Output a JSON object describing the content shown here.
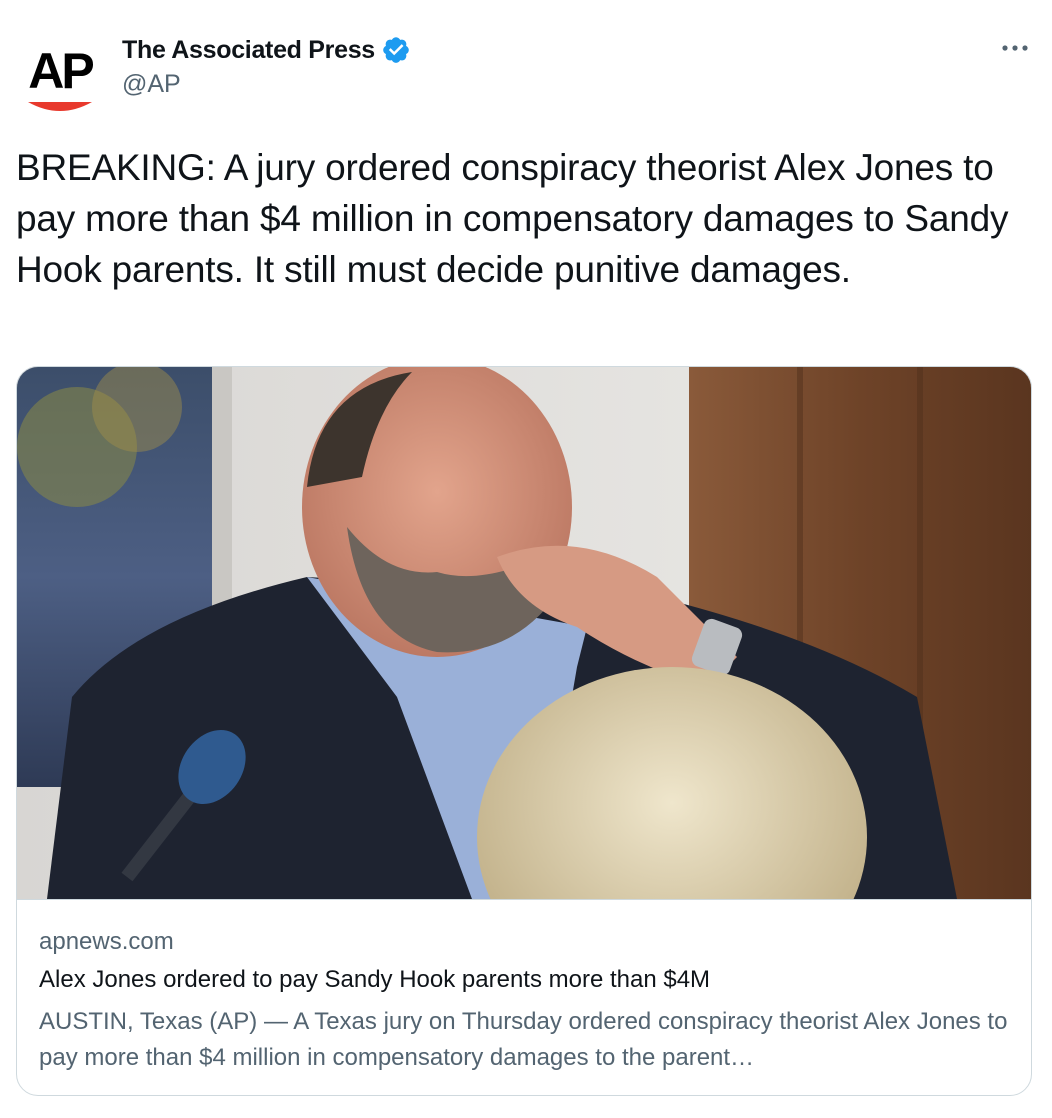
{
  "author": {
    "display_name": "The Associated Press",
    "handle": "@AP",
    "verified": true,
    "avatar_logo_text": "AP",
    "avatar_accent_color": "#e8392d"
  },
  "menu": {
    "icon": "more-horizontal-icon"
  },
  "tweet": {
    "text": "BREAKING: A jury ordered conspiracy theorist Alex Jones to pay more than $4 million in compensatory damages to Sandy Hook parents. It still must decide punitive damages."
  },
  "card": {
    "domain": "apnews.com",
    "title": "Alex Jones ordered to pay Sandy Hook parents more than $4M",
    "description": "AUSTIN, Texas (AP) — A Texas jury on Thursday ordered conspiracy theorist Alex Jones to pay more than $4 million in compensatory damages to the parent…"
  },
  "colors": {
    "verified_blue": "#1d9bf0",
    "text_primary": "#0f1419",
    "text_secondary": "#536471",
    "border": "#cfd9de"
  }
}
